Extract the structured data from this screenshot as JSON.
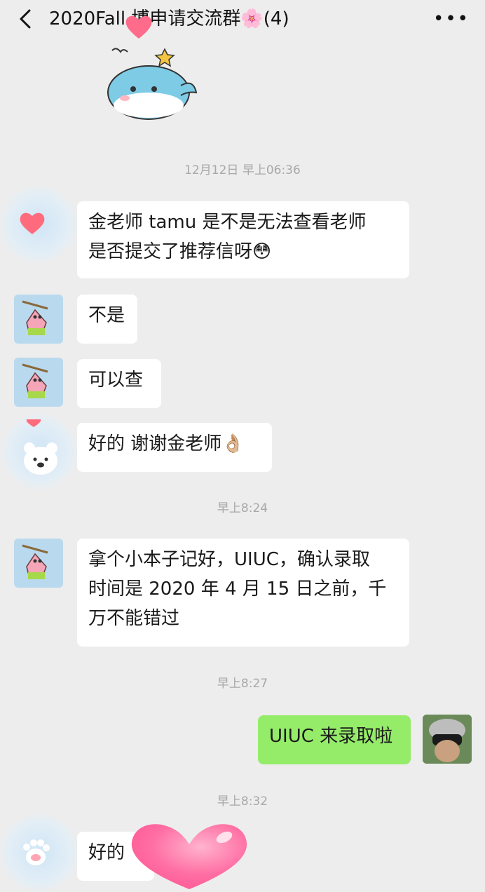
{
  "header": {
    "title": "2020Fall 博申请交流群🌸(4)",
    "more_label": "•••"
  },
  "messages": {
    "t1": "12月12日 早上06:36",
    "m1_line1": "金老师 tamu 是不是无法查看老师",
    "m1_line2": "是否提交了推荐信呀😳",
    "m2": "不是",
    "m3": "可以查",
    "m4": "好的 谢谢金老师👌🏼",
    "t2": "早上8:24",
    "m5_line1": "拿个小本子记好，UIUC，确认录取",
    "m5_line2": "时间是 2020 年 4 月 15 日之前，千",
    "m5_line3": "万不能错过",
    "t3": "早上8:27",
    "m6": "UIUC 来录取啦",
    "t4": "早上8:32",
    "m7": "好的"
  },
  "colors": {
    "background": "#ededed",
    "bubble_in": "#ffffff",
    "bubble_out": "#95ec69",
    "timestamp": "#a8a8a8",
    "sticker_heart": "#ff6b8a"
  },
  "icons": [
    "chevron-left-icon",
    "more-icon",
    "heart-sticker",
    "whale-sticker",
    "patrick-avatar",
    "bear-sticker",
    "paw-sticker"
  ]
}
